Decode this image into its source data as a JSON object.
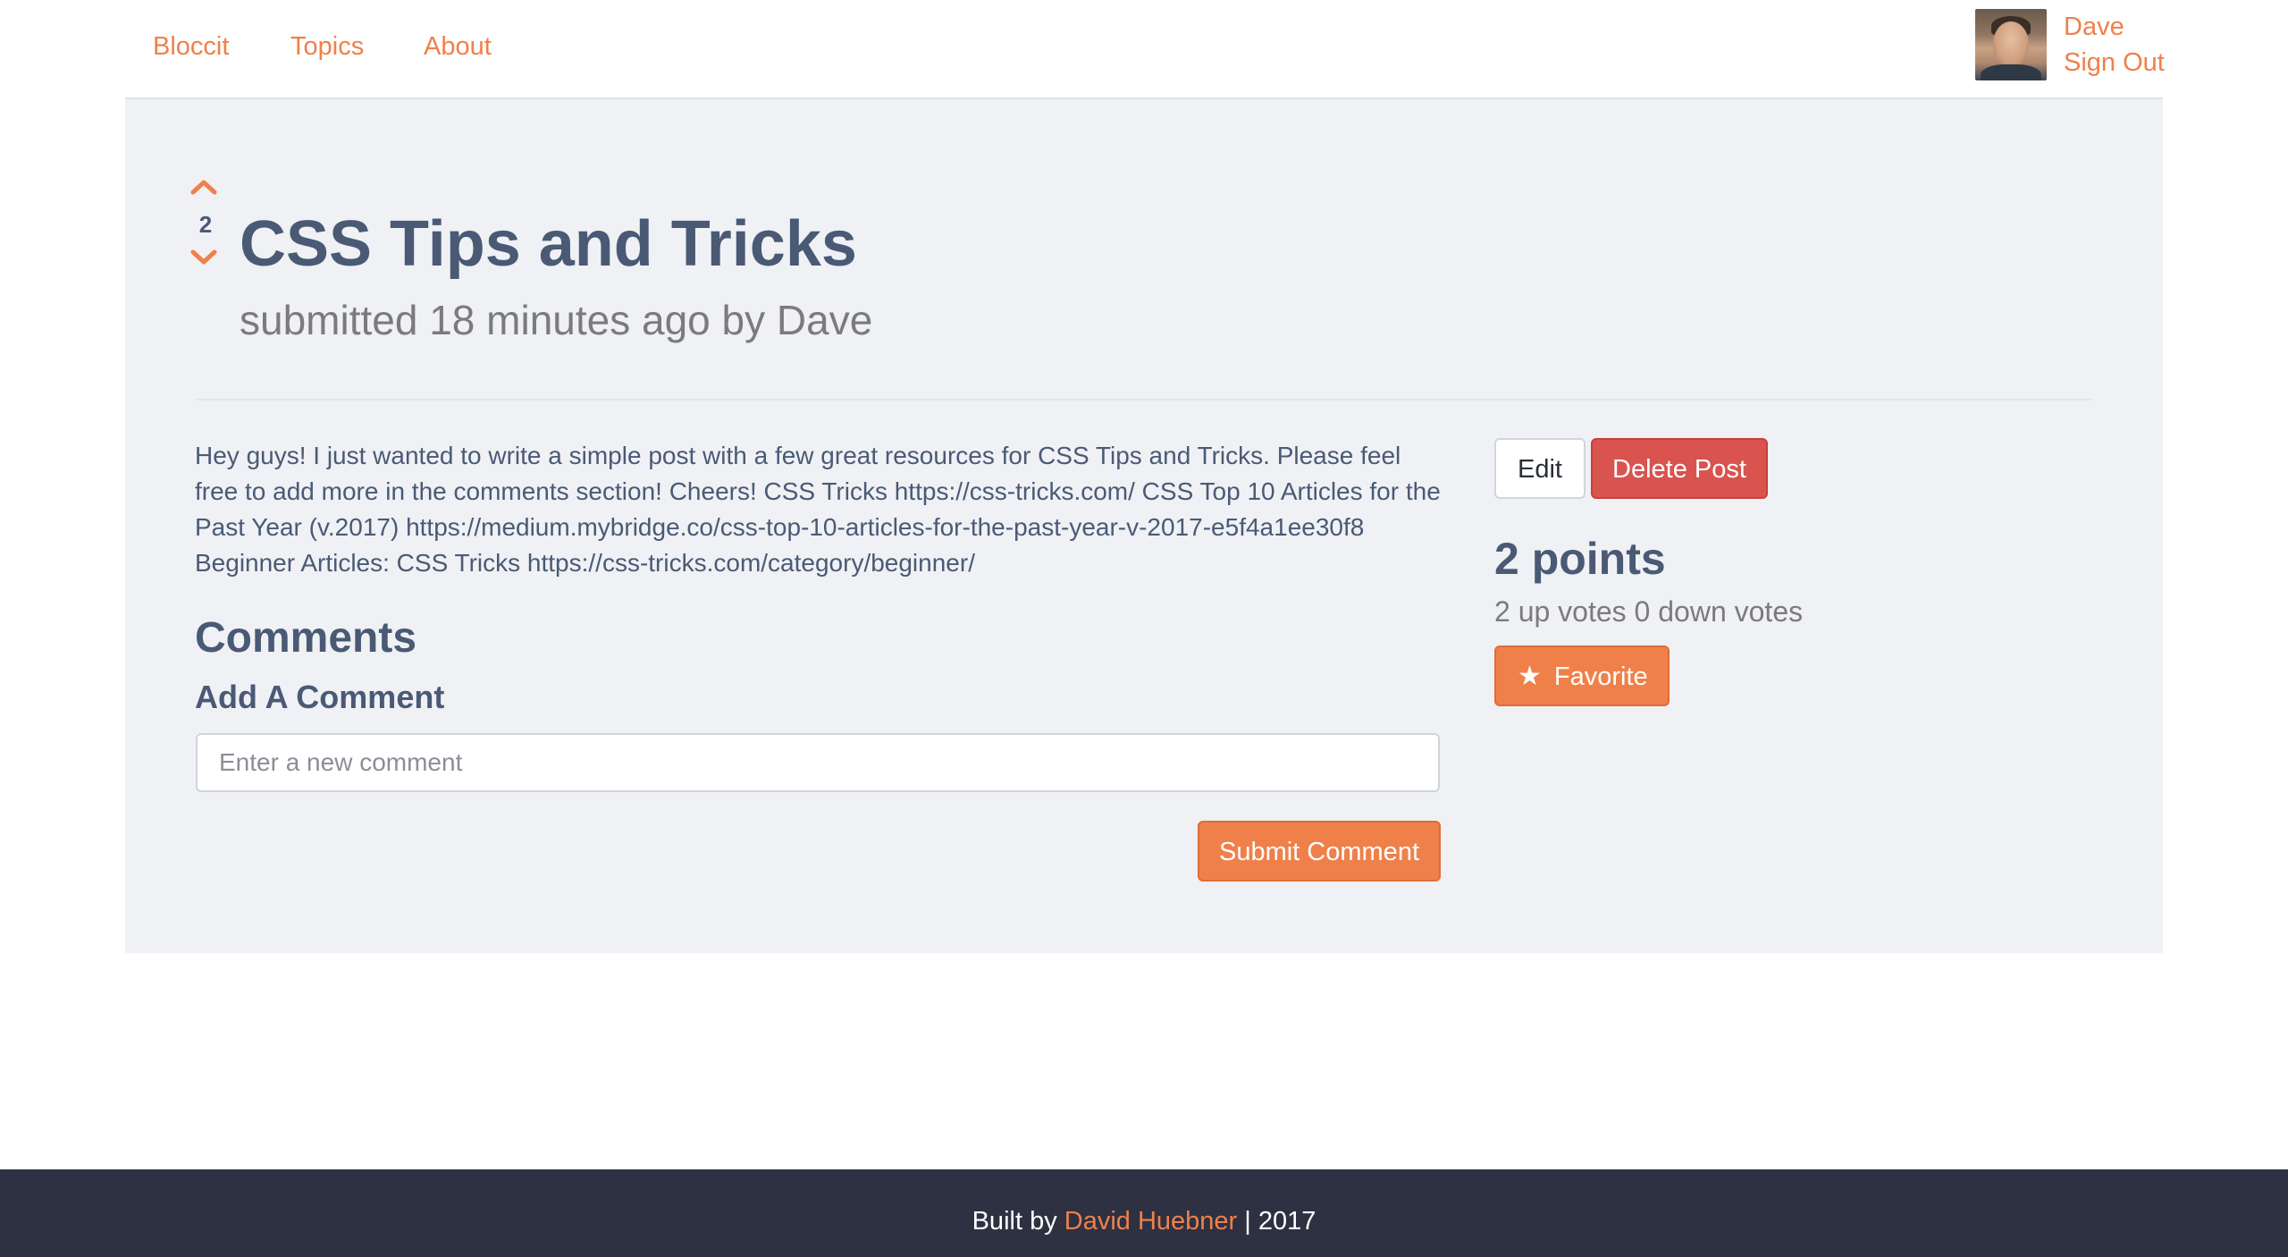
{
  "nav": {
    "brand": "Bloccit",
    "links": [
      "Topics",
      "About"
    ],
    "user_name": "Dave",
    "sign_out": "Sign Out"
  },
  "post": {
    "vote_count": "2",
    "title": "CSS Tips and Tricks",
    "meta": "submitted 18 minutes ago by Dave",
    "body": "Hey guys! I just wanted to write a simple post with a few great resources for CSS Tips and Tricks. Please feel free to add more in the comments section! Cheers! CSS Tricks https://css-tricks.com/ CSS Top 10 Articles for the Past Year (v.2017) https://medium.mybridge.co/css-top-10-articles-for-the-past-year-v-2017-e5f4a1ee30f8 Beginner Articles: CSS Tricks https://css-tricks.com/category/beginner/"
  },
  "comments": {
    "heading": "Comments",
    "add_heading": "Add A Comment",
    "input_placeholder": "Enter a new comment",
    "input_value": "",
    "submit_label": "Submit Comment"
  },
  "sidebar": {
    "edit_label": "Edit",
    "delete_label": "Delete Post",
    "points": "2 points",
    "votes_detail": "2 up votes 0 down votes",
    "favorite_label": "Favorite"
  },
  "footer": {
    "prefix": "Built by ",
    "author": "David Huebner",
    "suffix": " | 2017"
  },
  "colors": {
    "accent": "#f0804a",
    "danger": "#d9534f",
    "panel_bg": "#eff1f5",
    "footer_bg": "#2d3142",
    "heading_text": "#4a5a75"
  },
  "icons": {
    "vote_up": "chevron-up-icon",
    "vote_down": "chevron-down-icon",
    "favorite": "star-icon",
    "avatar": "user-avatar-photo"
  }
}
